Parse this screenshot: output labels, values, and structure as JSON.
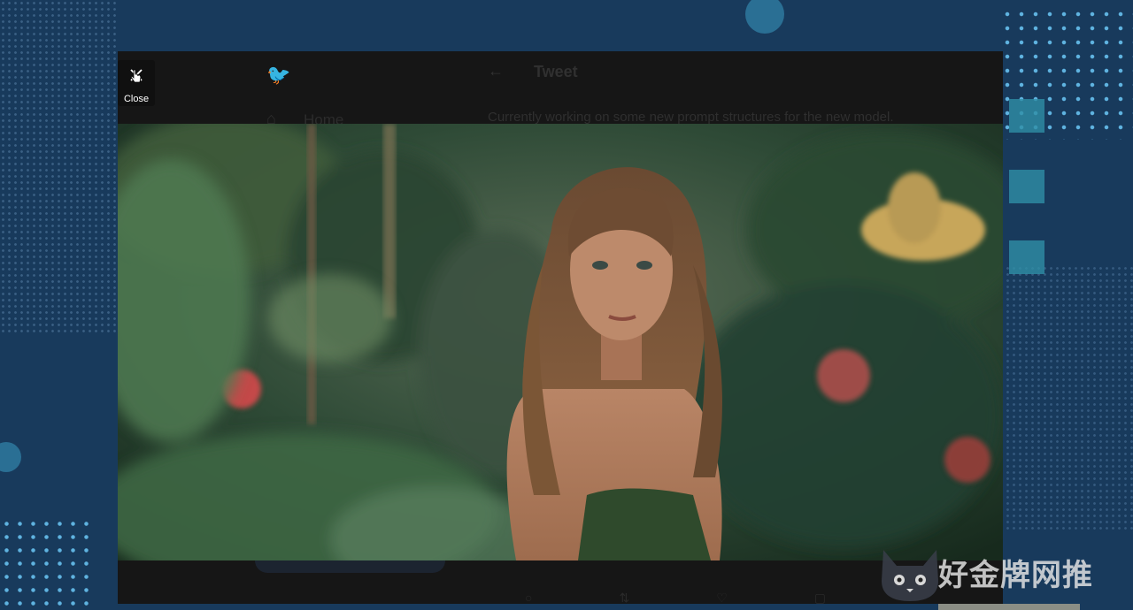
{
  "modal": {
    "close_label": "Close",
    "background_tweet": {
      "page_title": "Tweet",
      "nav_home": "Home",
      "tweet_text": "Currently working on some new prompt structures for the new model."
    }
  },
  "watermark": {
    "text": "好金牌网推"
  },
  "colors": {
    "page_background": "#183a5c",
    "modal_background": "#161616",
    "accent_dots": "#5fb3e0"
  },
  "icons": [
    "close-icon",
    "pointer-cursor-icon",
    "twitter-bird-icon",
    "back-arrow-icon",
    "home-icon",
    "cat-logo-icon"
  ]
}
